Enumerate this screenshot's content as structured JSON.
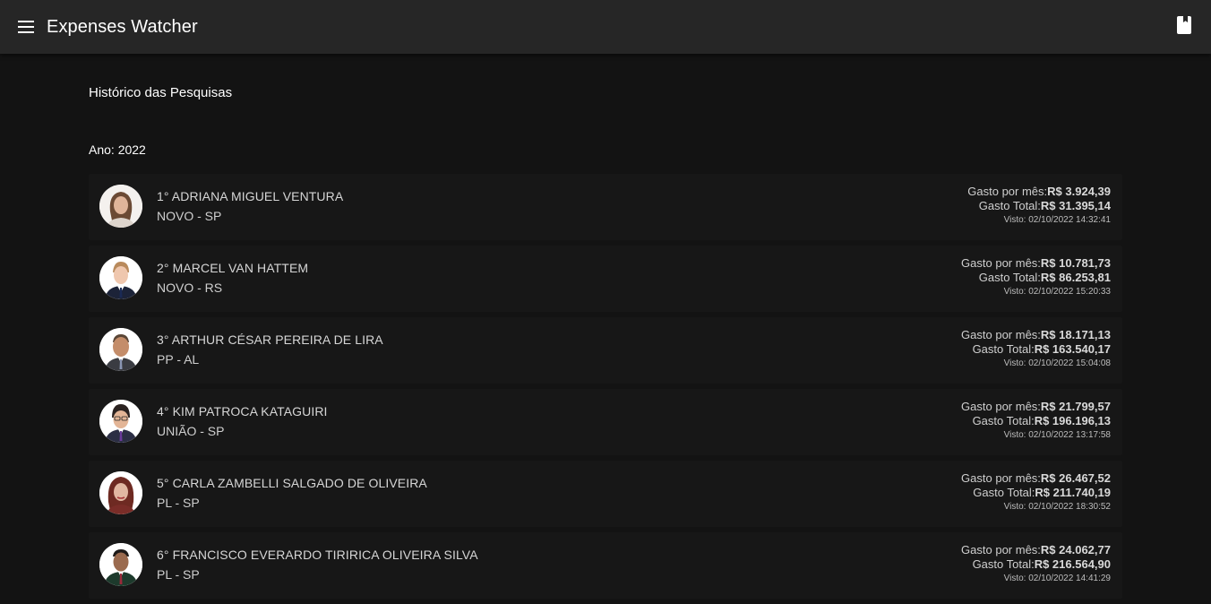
{
  "app": {
    "title": "Expenses Watcher",
    "menu_icon": "menu-icon",
    "bookmark_icon": "bookmark-icon"
  },
  "page": {
    "title": "Histórico das Pesquisas",
    "year_label": "Ano: 2022"
  },
  "labels": {
    "monthly": "Gasto por mês:",
    "total": "Gasto Total:"
  },
  "items": [
    {
      "rank_name": "1° ADRIANA MIGUEL VENTURA",
      "party": "NOVO - SP",
      "monthly": "R$ 3.924,39",
      "total": "R$ 31.395,14",
      "seen": "Visto: 02/10/2022 14:32:41"
    },
    {
      "rank_name": "2° MARCEL VAN HATTEM",
      "party": "NOVO - RS",
      "monthly": "R$ 10.781,73",
      "total": "R$ 86.253,81",
      "seen": "Visto: 02/10/2022 15:20:33"
    },
    {
      "rank_name": "3° ARTHUR CÉSAR PEREIRA DE LIRA",
      "party": "PP - AL",
      "monthly": "R$ 18.171,13",
      "total": "R$ 163.540,17",
      "seen": "Visto: 02/10/2022 15:04:08"
    },
    {
      "rank_name": "4° KIM PATROCA KATAGUIRI",
      "party": "UNIÃO - SP",
      "monthly": "R$ 21.799,57",
      "total": "R$ 196.196,13",
      "seen": "Visto: 02/10/2022 13:17:58"
    },
    {
      "rank_name": "5° CARLA ZAMBELLI SALGADO DE OLIVEIRA",
      "party": "PL - SP",
      "monthly": "R$ 26.467,52",
      "total": "R$ 211.740,19",
      "seen": "Visto: 02/10/2022 18:30:52"
    },
    {
      "rank_name": "6° FRANCISCO EVERARDO TIRIRICA OLIVEIRA SILVA",
      "party": "PL - SP",
      "monthly": "R$ 24.062,77",
      "total": "R$ 216.564,90",
      "seen": "Visto: 02/10/2022 14:41:29"
    }
  ]
}
